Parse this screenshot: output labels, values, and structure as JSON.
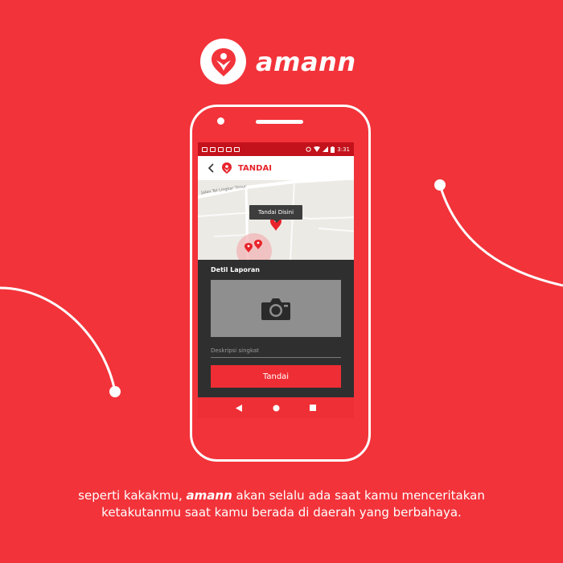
{
  "brand": {
    "name": "amann"
  },
  "phone": {
    "status_bar": {
      "time": "3:31",
      "left_icons": [
        "notification-icon",
        "message-icon",
        "photo-icon",
        "chat-icon",
        "mail-icon"
      ],
      "right_icons": [
        "alarm-icon",
        "wifi-icon",
        "signal-icon",
        "battery-icon"
      ]
    },
    "app_bar": {
      "title": "TANDAI"
    },
    "map": {
      "road_label": "Jalan Tol Lingkar Timur",
      "tooltip": "Tandai Disini"
    },
    "sheet": {
      "title": "Detil Laporan",
      "description_placeholder": "Deskripsi singkat",
      "submit_label": "Tandai"
    }
  },
  "caption": {
    "line1_before": "seperti kakakmu, ",
    "line1_brand": "amann",
    "line1_after": " akan selalu ada saat kamu menceritakan",
    "line2": "ketakutanmu saat kamu berada di daerah yang berbahaya."
  },
  "colors": {
    "background": "#f2333a",
    "status_bar": "#c3121b",
    "accent": "#e8232b",
    "sheet": "#2f2f2f"
  }
}
